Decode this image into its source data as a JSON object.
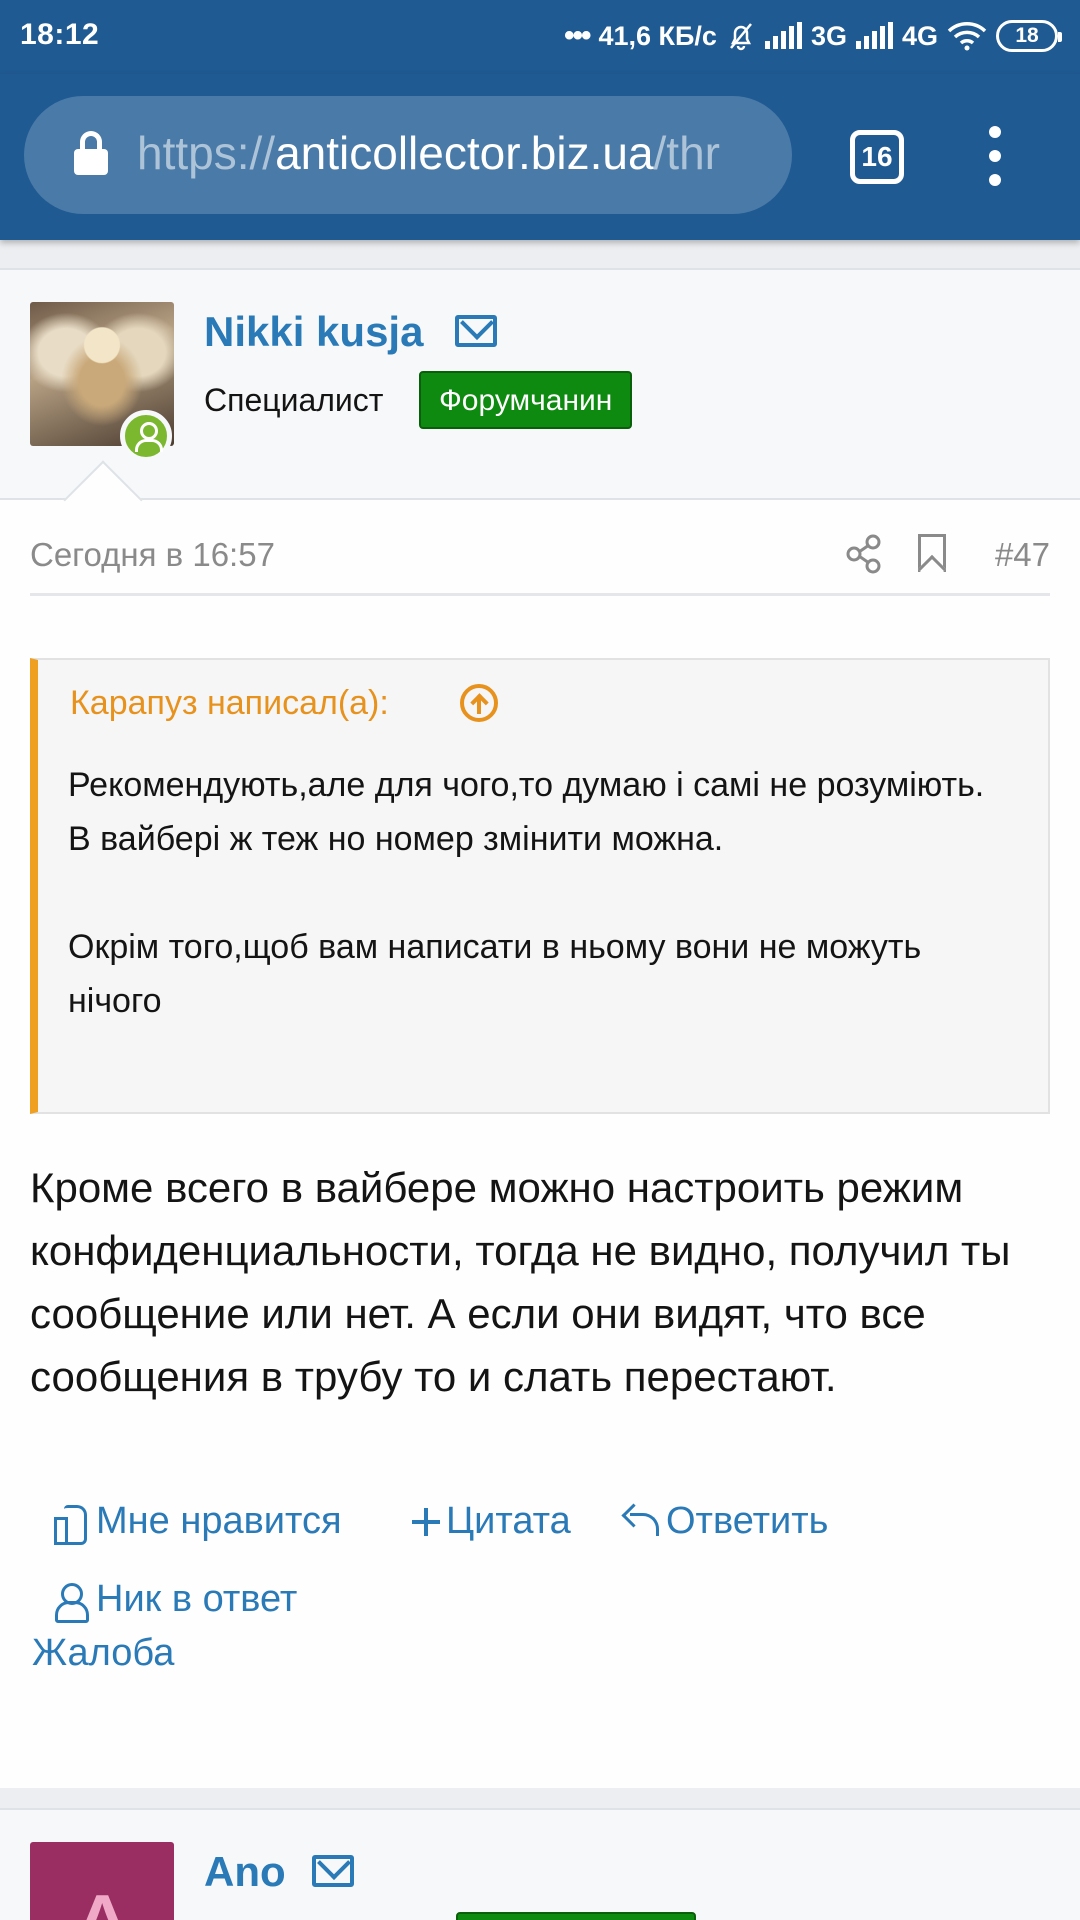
{
  "status_bar": {
    "time": "18:12",
    "network_speed": "41,6 КБ/с",
    "net_3g": "3G",
    "net_4g": "4G",
    "battery": "18"
  },
  "browser": {
    "url_scheme": "https://",
    "url_host": "anticollector.biz.ua",
    "url_path": "/thr",
    "tab_count": "16"
  },
  "post": {
    "username": "Nikki kusja",
    "user_title": "Специалист",
    "user_badge": "Форумчанин",
    "date": "Сегодня в 16:57",
    "post_number": "#47",
    "quote": {
      "author": "Карапуз написал(а):",
      "lines": [
        "Рекомендують,але для чого,то думаю і самі не розуміють.",
        "В вайбері ж теж но номер змінити можна.",
        "",
        "Окрім того,щоб вам написати в ньому вони не можуть нічого"
      ]
    },
    "message": "Кроме всего в вайбере можно настроить режим конфиденциальности, тогда не видно, получил ты сообщение или нет. А если они видят, что все сообщения в трубу то и слать перестают.",
    "actions": {
      "like": "Мне нравится",
      "quote": "Цитата",
      "reply": "Ответить",
      "mention": "Ник в ответ",
      "report": "Жалоба"
    }
  },
  "next_post": {
    "avatar_letter": "A",
    "username": "Ano"
  },
  "colors": {
    "header_bg": "#1f5a92",
    "link": "#2a7ab8",
    "badge_green": "#0f8a10",
    "quote_accent": "#f0a020"
  }
}
